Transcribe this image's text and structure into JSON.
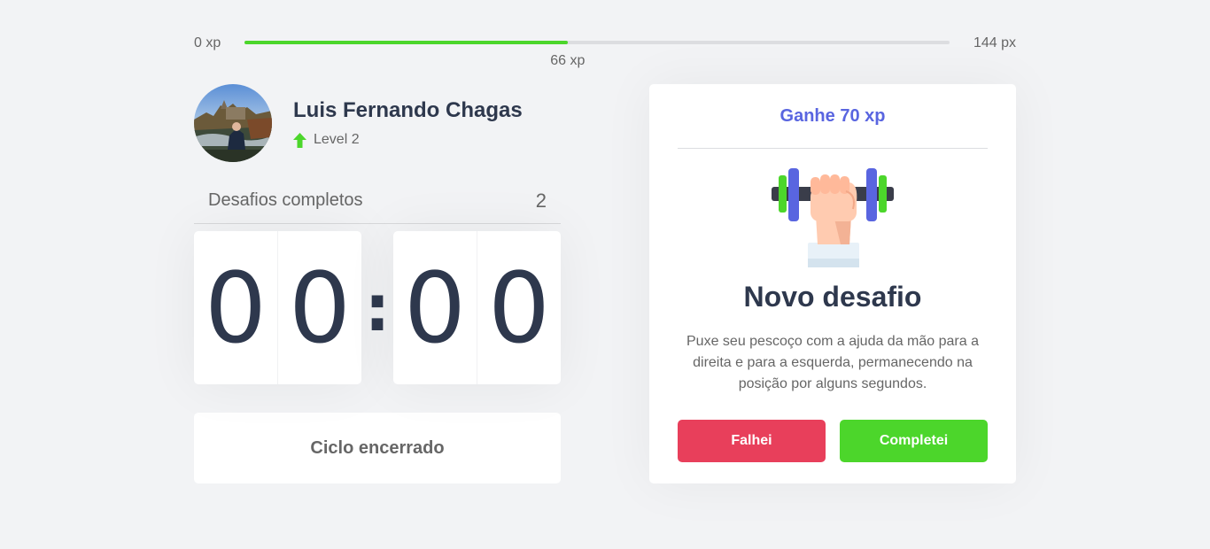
{
  "xp": {
    "min_label": "0 xp",
    "max_label": "144 px",
    "current_label": "66 xp",
    "current": 66,
    "max": 144,
    "fill_color": "#4cd62b"
  },
  "profile": {
    "name": "Luis Fernando Chagas",
    "level_label": "Level 2",
    "level_icon": "level-up-arrow-icon"
  },
  "completed": {
    "label": "Desafios completos",
    "count": "2"
  },
  "countdown": {
    "minute_left": "0",
    "minute_right": "0",
    "separator": ":",
    "second_left": "0",
    "second_right": "0"
  },
  "cycle_button": {
    "label": "Ciclo encerrado"
  },
  "challenge": {
    "header": "Ganhe 70 xp",
    "icon": "dumbbell-body-icon",
    "title": "Novo desafio",
    "description": "Puxe seu pescoço com a ajuda da mão para a direita e para a esquerda, permanecendo na posição por alguns segundos.",
    "fail_label": "Falhei",
    "complete_label": "Completei"
  },
  "colors": {
    "accent_blue": "#5965e0",
    "success_green": "#4cd62b",
    "fail_red": "#e83f5b",
    "title_dark": "#2e384d"
  }
}
